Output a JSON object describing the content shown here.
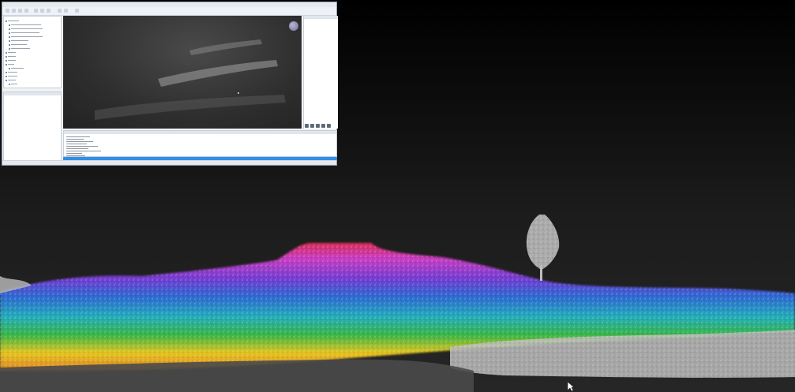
{
  "window": {
    "menu": [
      "",
      "",
      "",
      "",
      "",
      ""
    ],
    "status_text": ""
  },
  "tree": {
    "row_count": 18
  },
  "viewport_3d": {
    "compass_icon": "compass-icon"
  },
  "console": {
    "line_count": 9
  },
  "colors": {
    "app_border": "#9aa7b5",
    "progress": "#2f8fe8",
    "background_top": "#000000",
    "background_bottom": "#262626"
  },
  "point_cloud": {
    "elevation_colormap": [
      "#f08a24",
      "#f5d21f",
      "#39c24a",
      "#24b8c8",
      "#2f6fe0",
      "#7a3fe0",
      "#d83fd0",
      "#e8305a"
    ],
    "ground_color": "#cfcfcf"
  }
}
